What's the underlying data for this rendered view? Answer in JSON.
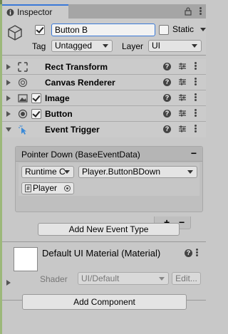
{
  "tab": {
    "label": "Inspector",
    "lock_icon": "lock-icon",
    "menu_icon": "more-vert-icon"
  },
  "game_object": {
    "active": true,
    "name": "Button B",
    "static_label": "Static",
    "static": false,
    "tag_label": "Tag",
    "tag_value": "Untagged",
    "layer_label": "Layer",
    "layer_value": "UI"
  },
  "components": [
    {
      "title": "Rect Transform",
      "icon": "rect-transform-icon",
      "has_checkbox": false,
      "expanded": false
    },
    {
      "title": "Canvas Renderer",
      "icon": "canvas-renderer-icon",
      "has_checkbox": false,
      "expanded": false
    },
    {
      "title": "Image",
      "icon": "image-icon",
      "has_checkbox": true,
      "enabled": true,
      "expanded": false
    },
    {
      "title": "Button",
      "icon": "button-icon",
      "has_checkbox": true,
      "enabled": true,
      "expanded": false
    },
    {
      "title": "Event Trigger",
      "icon": "event-trigger-icon",
      "has_checkbox": false,
      "expanded": true
    }
  ],
  "event_trigger": {
    "entry_title": "Pointer Down (BaseEventData)",
    "remove_label": "−",
    "runtime_value": "Runtime C",
    "function_value": "Player.ButtonBDown",
    "target_object": "Player",
    "add_label": "+",
    "remove_listener_label": "−",
    "add_event_type_label": "Add New Event Type"
  },
  "material": {
    "title": "Default UI Material (Material)",
    "shader_label": "Shader",
    "shader_value": "UI/Default",
    "edit_label": "Edit..."
  },
  "add_component_label": "Add Component",
  "colors": {
    "accent": "#3a79d8",
    "panel": "#c8c8c8",
    "header": "#cbcbcb"
  }
}
